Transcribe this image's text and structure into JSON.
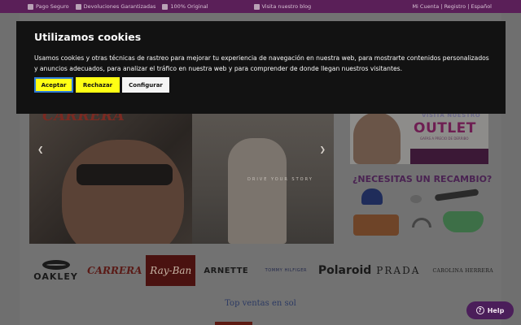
{
  "topbar": {
    "items": [
      {
        "icon": "lock-icon",
        "label": "Pago Seguro"
      },
      {
        "icon": "return-icon",
        "label": "Devoluciones Garantizadas"
      },
      {
        "icon": "check-icon",
        "label": "100% Original"
      }
    ],
    "blog": {
      "icon": "blog-icon",
      "label": "Visita nuestro blog"
    },
    "account": "Mi Cuenta | Registro | Español"
  },
  "hero": {
    "brandmark": "CARRERA",
    "tagline": "DRIVE YOUR STORY",
    "prev_arrow": "❮",
    "next_arrow": "❯"
  },
  "outlet": {
    "visita": "VISITA NUESTRO",
    "title": "OUTLET",
    "subtitle": "GAFAS A PRECIO DE DERRIBO"
  },
  "recambio": {
    "title": "¿NECESITAS UN RECAMBIO?"
  },
  "brands": {
    "oakley": "OAKLEY",
    "carrera": "CARRERA",
    "rayban": "Ray-Ban",
    "arnette": "ARNETTE",
    "tommy": "TOMMY HILFIGER",
    "polaroid": "Polaroid",
    "prada": "PRADA",
    "carolina_herrera": "CAROLINA HERRERA"
  },
  "top_ventas": "Top ventas en sol",
  "cookie": {
    "title": "Utilizamos cookies",
    "text": "Usamos cookies y otras técnicas de rastreo para mejorar tu experiencia de navegación en nuestra web, para mostrarte contenidos personalizados y anuncios adecuados, para analizar el tráfico en nuestra web y para comprender de donde llegan nuestros visitantes.",
    "accept": "Aceptar",
    "reject": "Rechazar",
    "configure": "Configurar"
  },
  "help": {
    "label": "Help",
    "icon": "question-icon"
  },
  "colors": {
    "topbar": "#5a1f58",
    "accept": "#ffff14",
    "help": "#4b1e5a"
  }
}
